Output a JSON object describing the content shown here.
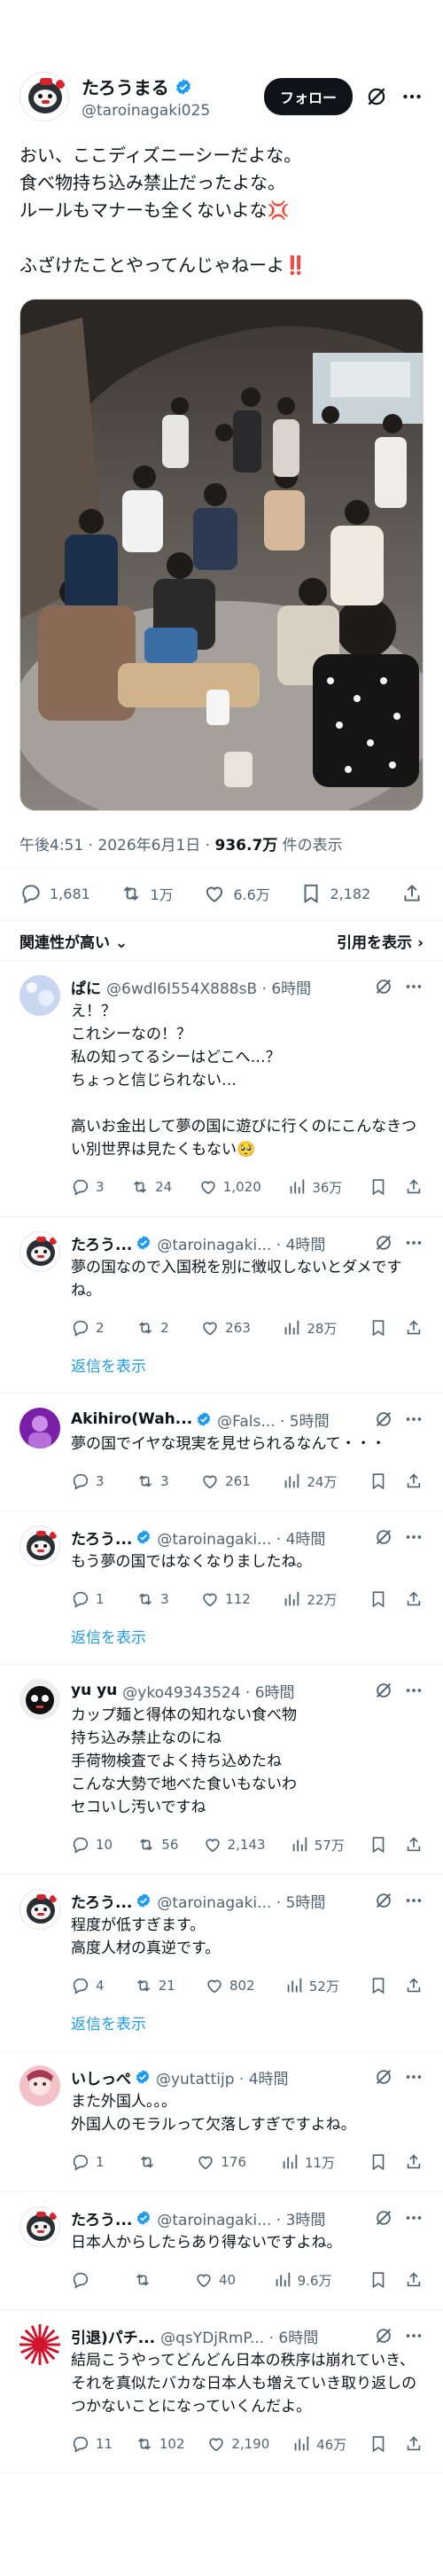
{
  "post": {
    "display_name": "たろうまる",
    "handle": "@taroinagaki025",
    "follow_label": "フォロー",
    "text": "おい、ここディズニーシーだよな。\n食べ物持ち込み禁止だったよな。\nルールもマナーも全くないよな💢\n\nふざけたことやってんじゃねーよ‼️",
    "time": "午後4:51 · 2026年6月1日 · ",
    "views": "936.7万",
    "views_suffix": " 件の表示",
    "stats": {
      "replies": "1,681",
      "reposts": "1万",
      "likes": "6.6万",
      "bookmarks": "2,182"
    },
    "sort_label": "関連性が高い",
    "quotes_label": "引用を表示"
  },
  "replies": [
    {
      "name": "ぱに",
      "handle": "@6wdl6I554X888sB · 6時間",
      "text": "え！？\nこれシーなの！？\n私の知ってるシーはどこへ…？\nちょっと信じられない…\n\n高いお金出して夢の国に遊びに行くのにこんなきつい別世界は見たくもない🥺",
      "replies": "3",
      "reposts": "24",
      "likes": "1,020",
      "views": "36万",
      "show_replies": ""
    },
    {
      "name": "たろう...",
      "handle": "@taroinagaki... · 4時間",
      "text": "夢の国なので入国税を別に徴収しないとダメですね。",
      "replies": "2",
      "reposts": "2",
      "likes": "263",
      "views": "28万",
      "show_replies": "返信を表示"
    },
    {
      "name": "Akihiro(Wah...",
      "handle": "@Fals... · 5時間",
      "text": "夢の国でイヤな現実を見せられるなんて・・・",
      "replies": "3",
      "reposts": "3",
      "likes": "261",
      "views": "24万",
      "show_replies": ""
    },
    {
      "name": "たろう...",
      "handle": "@taroinagaki... · 4時間",
      "text": "もう夢の国ではなくなりましたね。",
      "replies": "1",
      "reposts": "3",
      "likes": "112",
      "views": "22万",
      "show_replies": "返信を表示"
    },
    {
      "name": "yu yu",
      "handle": "@yko49343524 · 6時間",
      "text": "カップ麺と得体の知れない食べ物\n持ち込み禁止なのにね\n手荷物検査でよく持ち込めたね\nこんな大勢で地べた食いもないわ\nセコいし汚いですね",
      "replies": "10",
      "reposts": "56",
      "likes": "2,143",
      "views": "57万",
      "show_replies": ""
    },
    {
      "name": "たろう...",
      "handle": "@taroinagaki... · 5時間",
      "text": "程度が低すぎます。\n高度人材の真逆です。",
      "replies": "4",
      "reposts": "21",
      "likes": "802",
      "views": "52万",
      "show_replies": "返信を表示"
    },
    {
      "name": "いしっぺ",
      "handle": "@yutattijp · 4時間",
      "text": "また外国人。。。\n外国人のモラルって欠落しすぎですよね。",
      "replies": "1",
      "reposts": "",
      "likes": "176",
      "views": "11万",
      "show_replies": ""
    },
    {
      "name": "たろう...",
      "handle": "@taroinagaki... · 3時間",
      "text": "日本人からしたらあり得ないですよね。",
      "replies": "",
      "reposts": "",
      "likes": "40",
      "views": "9.6万",
      "show_replies": ""
    },
    {
      "name": "引退)パチ...",
      "handle": "@qsYDjRmP... · 6時間",
      "text": "結局こうやってどんどん日本の秩序は崩れていき、それを真似たバカな日本人も増えていき取り返しのつかないことになっていくんだよ。",
      "replies": "11",
      "reposts": "102",
      "likes": "2,190",
      "views": "46万",
      "show_replies": ""
    }
  ],
  "colors": {
    "link": "#1d9bf0",
    "verified": "#1d9bf0",
    "muted": "#536471"
  }
}
